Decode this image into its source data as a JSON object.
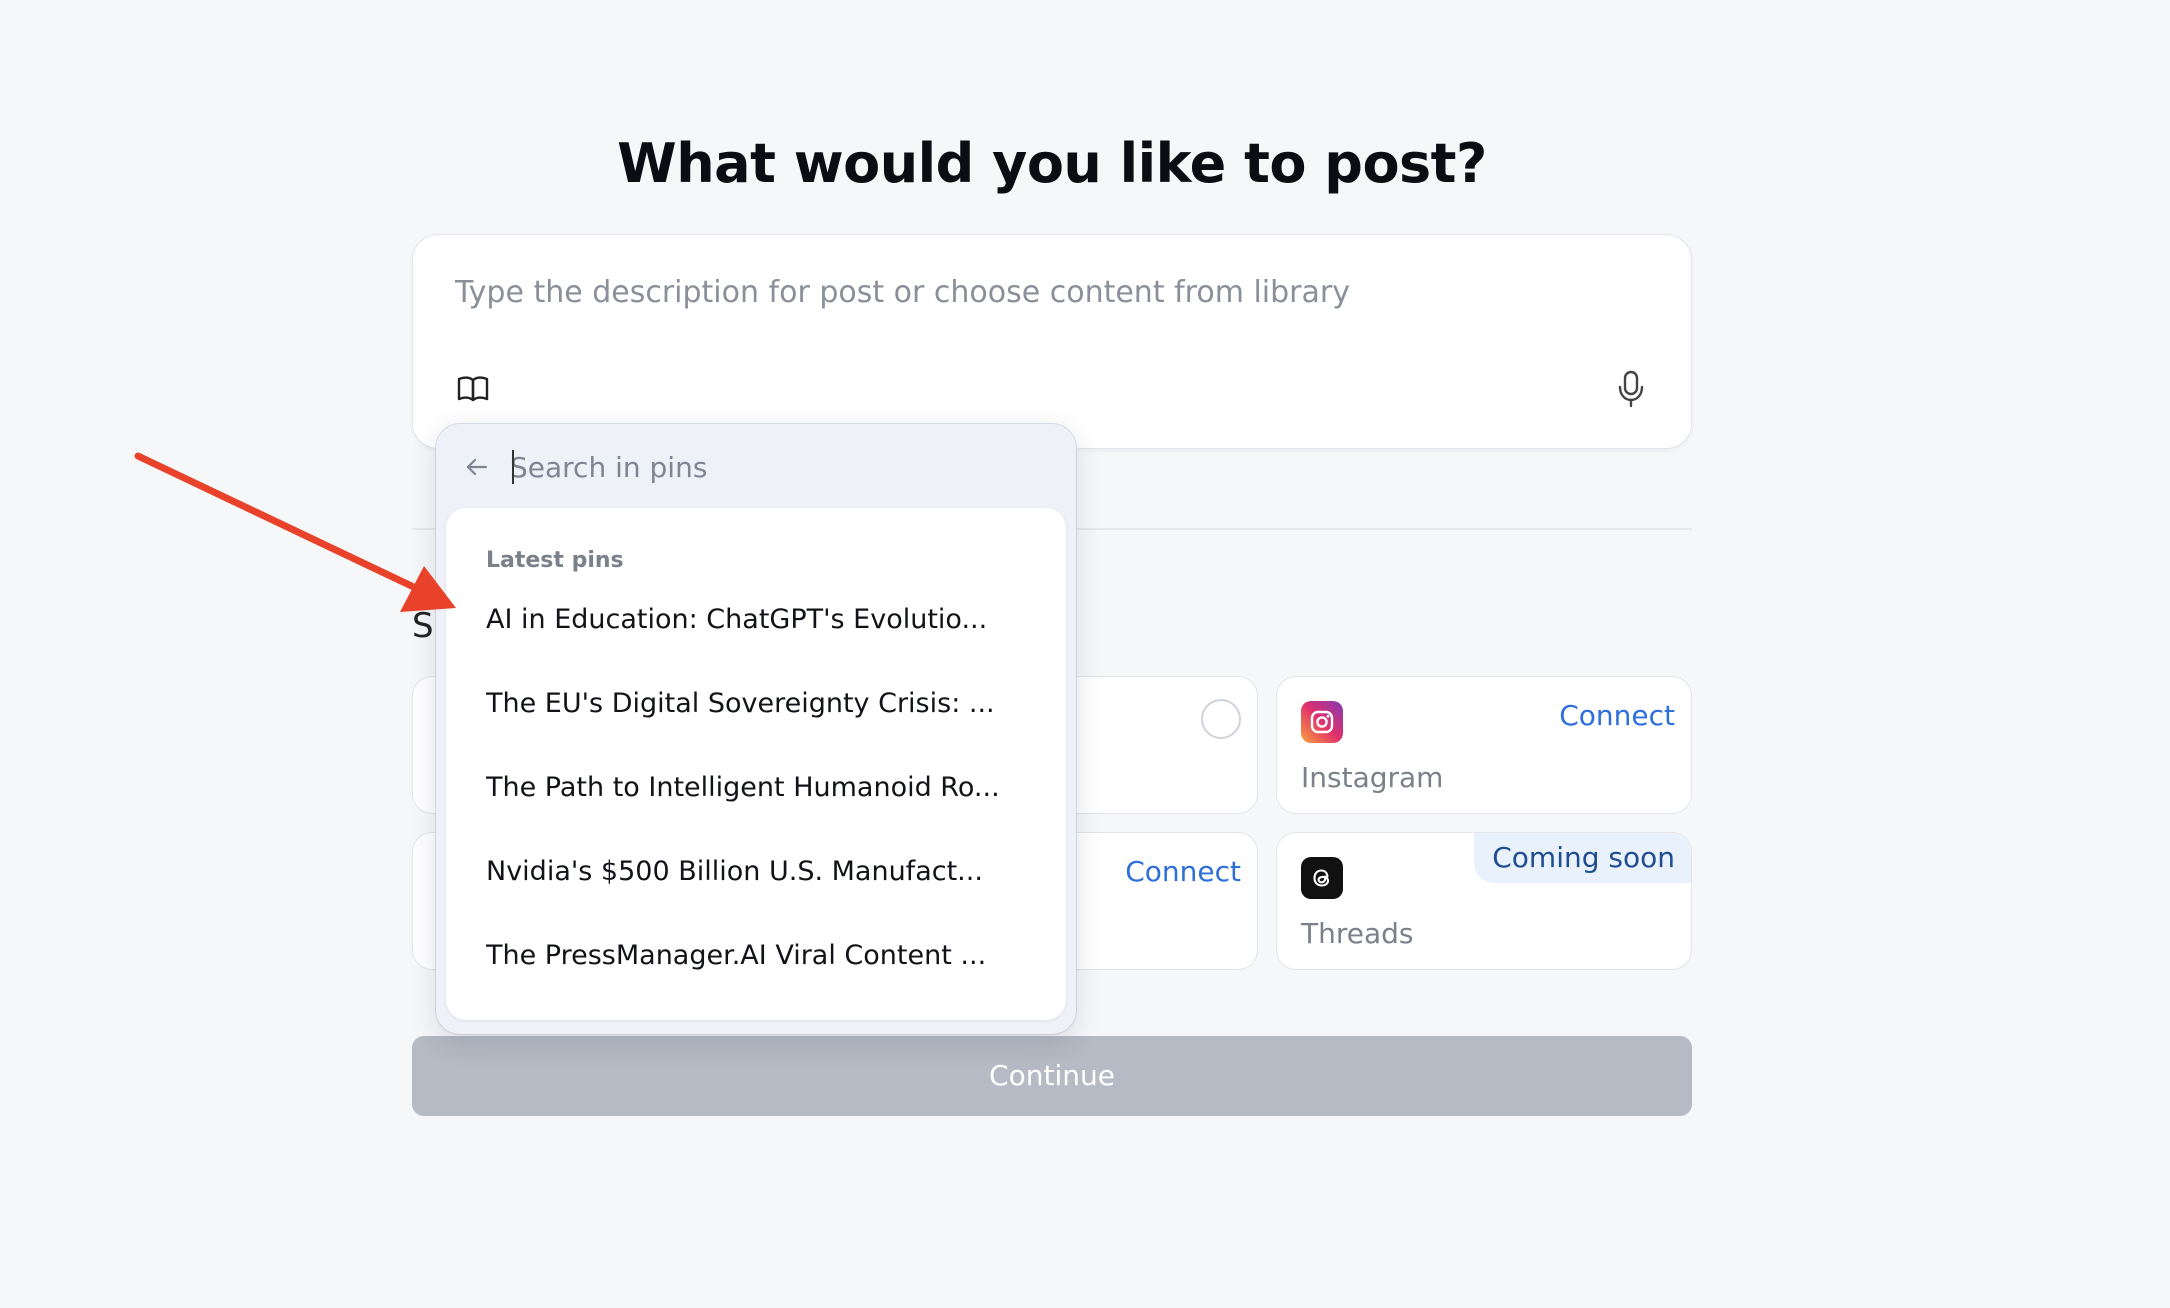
{
  "header": {
    "title": "What would you like to post?"
  },
  "composer": {
    "placeholder": "Type the description for post or choose content from library",
    "library_icon": "book-open-icon",
    "mic_icon": "microphone-icon"
  },
  "section": {
    "partial_heading": "S"
  },
  "platforms": [
    {
      "name": "",
      "state": "radio"
    },
    {
      "name": "Instagram",
      "action": "Connect",
      "icon": "instagram-icon"
    },
    {
      "name": "",
      "action": "Connect"
    },
    {
      "name": "Threads",
      "badge": "Coming soon",
      "icon": "threads-icon"
    }
  ],
  "continue_label": "Continue",
  "pins_popover": {
    "search_placeholder": "Search in pins",
    "back_icon": "arrow-left-icon",
    "heading": "Latest pins",
    "items": [
      "AI in Education: ChatGPT's Evolutio...",
      "The EU's Digital Sovereignty Crisis: ...",
      "The Path to Intelligent Humanoid Ro...",
      "Nvidia's $500 Billion U.S. Manufact...",
      "The PressManager.AI Viral Content ..."
    ]
  },
  "colors": {
    "accent": "#2f6fdb",
    "annotation_arrow": "#e8432a",
    "continue_disabled": "#b5bac4"
  }
}
